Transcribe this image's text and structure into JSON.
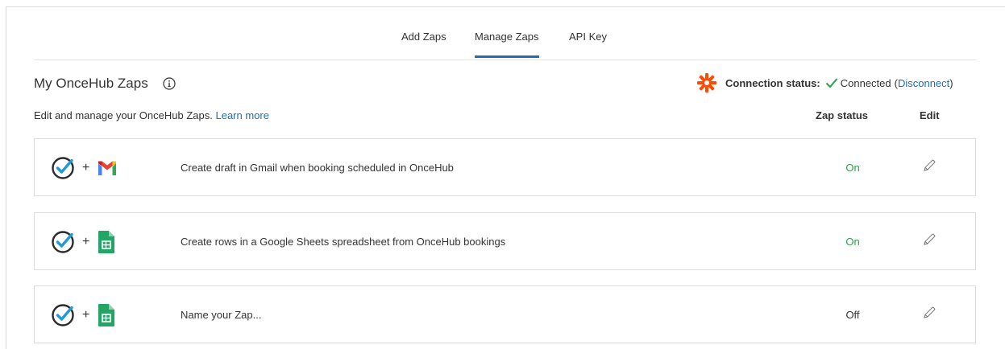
{
  "tabs": [
    {
      "label": "Add Zaps",
      "active": false
    },
    {
      "label": "Manage Zaps",
      "active": true
    },
    {
      "label": "API Key",
      "active": false
    }
  ],
  "header": {
    "title": "My OnceHub Zaps",
    "info_icon": "info-circle-icon",
    "subtitle_text": "Edit and manage your OnceHub Zaps.",
    "learn_more": "Learn more"
  },
  "connection": {
    "label": "Connection status:",
    "state": "Connected",
    "open_paren": "(",
    "link": "Disconnect",
    "close_paren": ")",
    "state_icon": "check-icon"
  },
  "columns": {
    "status": "Zap status",
    "edit": "Edit"
  },
  "zaps": [
    {
      "plus": "+",
      "target_app": "gmail",
      "name": "Create draft in Gmail when booking scheduled in OnceHub",
      "status": "On"
    },
    {
      "plus": "+",
      "target_app": "google-sheets",
      "name": "Create rows in a Google Sheets spreadsheet from OnceHub bookings",
      "status": "On"
    },
    {
      "plus": "+",
      "target_app": "google-sheets",
      "name": "Name your Zap...",
      "status": "Off"
    }
  ],
  "colors": {
    "accent": "#1f6fb2",
    "zapier_orange": "#ff4a00",
    "connected_green": "#2e9e4f",
    "status_on": "#2e9e4f",
    "status_off": "#333333",
    "oncehub_check": "#1e9bd7"
  }
}
